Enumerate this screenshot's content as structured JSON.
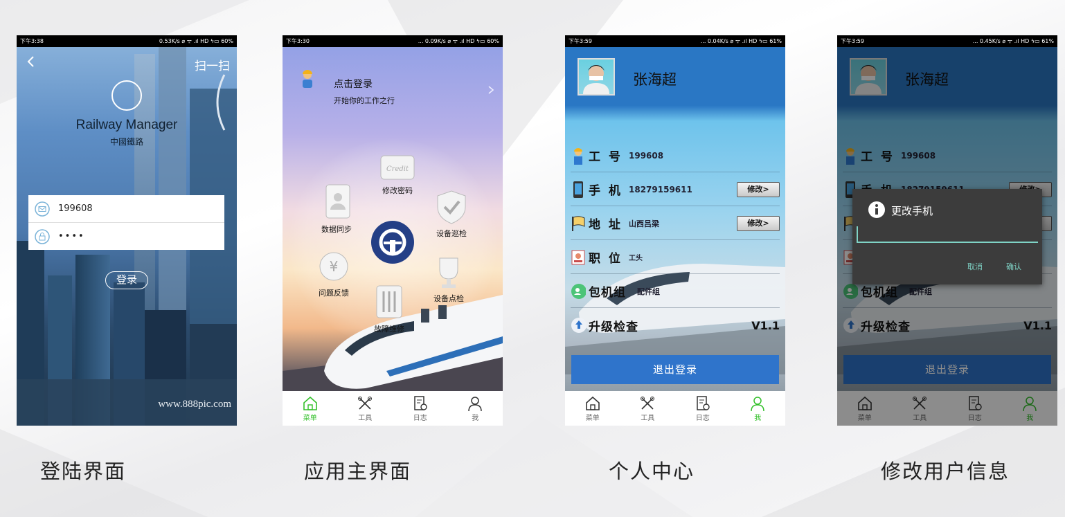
{
  "login": {
    "status": {
      "time": "下午3:38",
      "right": "0.53K/s ⌀ ᯤ .ıl HD ϟ▭ 60%"
    },
    "back_icon": "chevron-left-icon",
    "scan_label": "扫一扫",
    "app_title": "Railway Manager",
    "app_subtitle": "中國鐵路",
    "username_value": "199608",
    "password_value": "••••",
    "login_button": "登录",
    "watermark": "www.888pic.com"
  },
  "main": {
    "status": {
      "time": "下午3:30",
      "right": "... 0.09K/s ⌀ ᯤ .ıl HD ϟ▭ 60%"
    },
    "login_prompt": "点击登录",
    "login_sub": "开始你的工作之行",
    "menu": {
      "change_password": "修改密码",
      "data_sync": "数据同步",
      "device_patrol": "设备巡检",
      "feedback": "问题反馈",
      "device_check": "设备点检",
      "fault_repair": "故障维修"
    },
    "credit_text": "Credit"
  },
  "tabs": {
    "menu": "菜单",
    "tools": "工具",
    "log": "日志",
    "me": "我"
  },
  "profile": {
    "status": {
      "time": "下午3:59",
      "right": "... 0.04K/s ⌀ ᯤ .ıl HD ϟ▭ 61%"
    },
    "name": "张海超",
    "rows": {
      "id_label": "工 号",
      "id_value": "199608",
      "phone_label": "手 机",
      "phone_value": "18279159611",
      "addr_label": "地 址",
      "addr_value": "山西吕梁",
      "job_label": "职 位",
      "job_value": "工头",
      "group_label": "包机组",
      "group_value": "配件组",
      "upgrade_label": "升级检查",
      "version": "V1.1"
    },
    "modify_button": "修改>",
    "logout_button": "退出登录"
  },
  "edit": {
    "status": {
      "time": "下午3:59",
      "right": "... 0.45K/s ⌀ ᯤ .ıl HD ϟ▭ 61%"
    },
    "phone_partial": "18279159611",
    "dialog": {
      "title": "更改手机",
      "input_value": "",
      "cancel": "取消",
      "confirm": "确认"
    }
  },
  "captions": {
    "login": "登陆界面",
    "main": "应用主界面",
    "profile": "个人中心",
    "edit": "修改用户信息"
  },
  "colors": {
    "accent_green": "#33c02a",
    "logout_blue": "#2f74cb",
    "dialog_teal": "#7fd3c6"
  }
}
